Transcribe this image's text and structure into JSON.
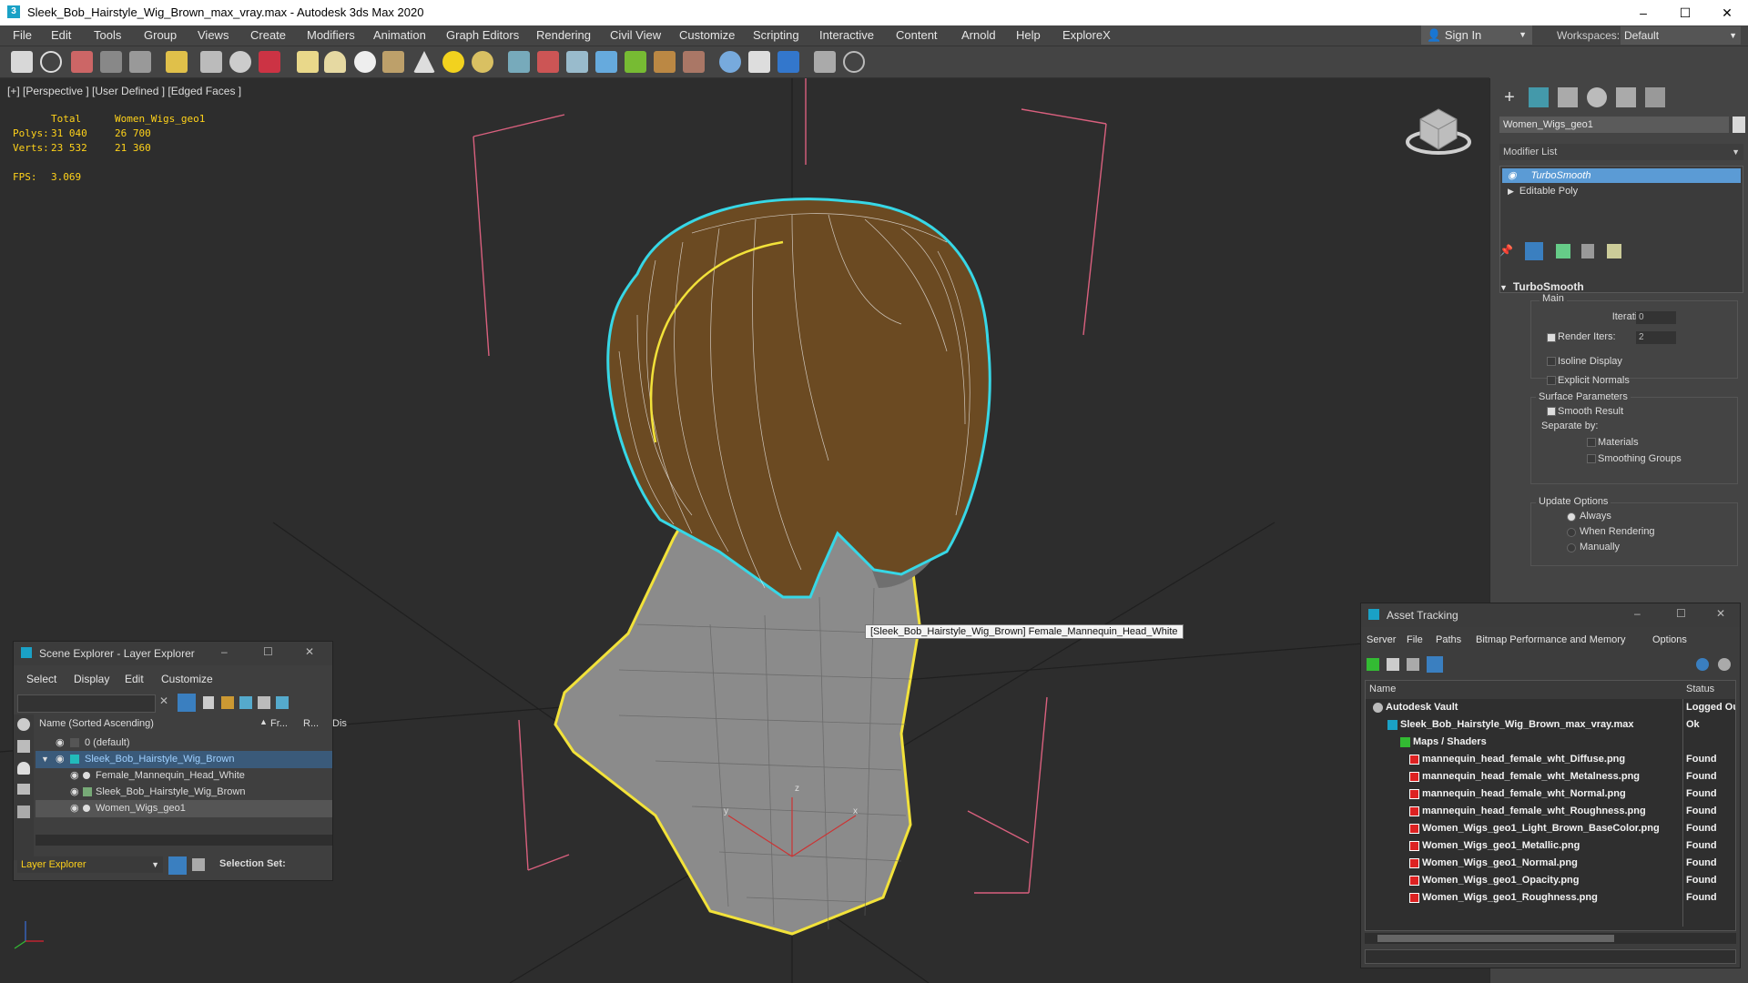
{
  "window": {
    "title": "Sleek_Bob_Hairstyle_Wig_Brown_max_vray.max - Autodesk 3ds Max 2020",
    "controls": [
      "–",
      "☐",
      "✕"
    ]
  },
  "menubar": {
    "items": [
      "File",
      "Edit",
      "Tools",
      "Group",
      "Views",
      "Create",
      "Modifiers",
      "Animation",
      "Graph Editors",
      "Rendering",
      "Civil View",
      "Customize",
      "Scripting",
      "Interactive",
      "Content",
      "Arnold",
      "Help",
      "ExploreX"
    ],
    "signin": "Sign In",
    "workspaces_label": "Workspaces:",
    "workspace_value": "Default"
  },
  "toolbar": {
    "icons": [
      "teapot-icon",
      "cloud-icon",
      "render-frame-icon",
      "layer-icon",
      "grid-icon",
      "light-icon",
      "move-icon",
      "orbit-icon",
      "particles-icon",
      "box-icon",
      "dome-icon",
      "sphere-icon",
      "hat-icon",
      "cone-icon",
      "sun-icon",
      "globe-icon",
      "mesh-icon",
      "molecule-icon",
      "graph-icon",
      "gear-icon",
      "plant-icon",
      "hair-icon",
      "head-icon",
      "earth-icon",
      "screen-icon",
      "render-icon",
      "save-icon",
      "help-icon"
    ]
  },
  "viewport": {
    "label": "[+] [Perspective ] [User Defined ] [Edged Faces ]",
    "stats": {
      "total_label": "Total",
      "object_label": "Women_Wigs_geo1",
      "polys_label": "Polys:",
      "polys_total": "31 040",
      "polys_object": "26 700",
      "verts_label": "Verts:",
      "verts_total": "23 532",
      "verts_object": "21 360",
      "fps_label": "FPS:",
      "fps_value": "3.069"
    },
    "tooltip": "[Sleek_Bob_Hairstyle_Wig_Brown] Female_Mannequin_Head_White",
    "gizmo_labels": [
      "z",
      "y",
      "x"
    ]
  },
  "command_panel": {
    "object_name": "Women_Wigs_geo1",
    "modifier_list_label": "Modifier List",
    "stack": [
      "TurboSmooth",
      "Editable Poly"
    ],
    "rollout_title": "TurboSmooth",
    "main_label": "Main",
    "iterations_label": "Iterations:",
    "iterations_value": "0",
    "render_iters_label": "Render Iters:",
    "render_iters_value": "2",
    "isoline_label": "Isoline Display",
    "explicit_normals_label": "Explicit Normals",
    "surface_params_label": "Surface Parameters",
    "smooth_result_label": "Smooth Result",
    "separate_by_label": "Separate by:",
    "materials_label": "Materials",
    "smoothing_groups_label": "Smoothing Groups",
    "update_options_label": "Update Options",
    "always_label": "Always",
    "when_rendering_label": "When Rendering",
    "manually_label": "Manually"
  },
  "scene_explorer": {
    "title": "Scene Explorer - Layer Explorer",
    "menus": [
      "Select",
      "Display",
      "Edit",
      "Customize"
    ],
    "columns": [
      "Name (Sorted Ascending)",
      "Fr...",
      "R...",
      "Dis"
    ],
    "rows": [
      {
        "name": "0 (default)"
      },
      {
        "name": "Sleek_Bob_Hairstyle_Wig_Brown"
      },
      {
        "name": "Female_Mannequin_Head_White"
      },
      {
        "name": "Sleek_Bob_Hairstyle_Wig_Brown"
      },
      {
        "name": "Women_Wigs_geo1"
      }
    ],
    "footer_dropdown": "Layer Explorer",
    "selection_set_label": "Selection Set:"
  },
  "asset_tracking": {
    "title": "Asset Tracking",
    "menus": [
      "Server",
      "File",
      "Paths",
      "Bitmap Performance and Memory",
      "Options"
    ],
    "col_name": "Name",
    "col_status": "Status",
    "rows": [
      {
        "name": "Autodesk Vault",
        "status": "Logged Ou"
      },
      {
        "name": "Sleek_Bob_Hairstyle_Wig_Brown_max_vray.max",
        "status": "Ok"
      },
      {
        "name": "Maps / Shaders",
        "status": ""
      },
      {
        "name": "mannequin_head_female_wht_Diffuse.png",
        "status": "Found"
      },
      {
        "name": "mannequin_head_female_wht_Metalness.png",
        "status": "Found"
      },
      {
        "name": "mannequin_head_female_wht_Normal.png",
        "status": "Found"
      },
      {
        "name": "mannequin_head_female_wht_Roughness.png",
        "status": "Found"
      },
      {
        "name": "Women_Wigs_geo1_Light_Brown_BaseColor.png",
        "status": "Found"
      },
      {
        "name": "Women_Wigs_geo1_Metallic.png",
        "status": "Found"
      },
      {
        "name": "Women_Wigs_geo1_Normal.png",
        "status": "Found"
      },
      {
        "name": "Women_Wigs_geo1_Opacity.png",
        "status": "Found"
      },
      {
        "name": "Women_Wigs_geo1_Roughness.png",
        "status": "Found"
      }
    ]
  },
  "colors": {
    "selection_highlight": "#5b9bd5",
    "stats_yellow": "#ffd21a",
    "hair_brown": "#6b4a22",
    "selection_cyan": "#37d7e6",
    "outline_yellow": "#f2e23a"
  }
}
